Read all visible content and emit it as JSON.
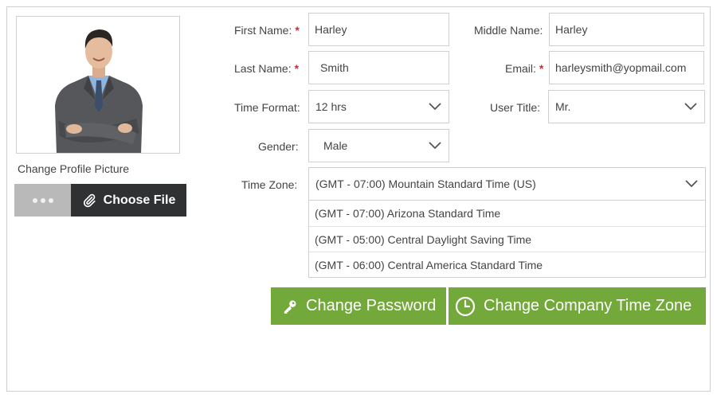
{
  "profile": {
    "change_picture_label": "Change Profile Picture",
    "choose_file_label": "Choose File"
  },
  "form": {
    "first_name": {
      "label": "First Name:",
      "required": "*",
      "value": "Harley"
    },
    "middle_name": {
      "label": "Middle Name:",
      "value": "Harley"
    },
    "last_name": {
      "label": "Last Name:",
      "required": "*",
      "value": "Smith"
    },
    "email": {
      "label": "Email:",
      "required": "*",
      "value": "harleysmith@yopmail.com"
    },
    "time_format": {
      "label": "Time Format:",
      "value": "12 hrs"
    },
    "user_title": {
      "label": "User Title:",
      "value": "Mr."
    },
    "gender": {
      "label": "Gender:",
      "value": "Male"
    },
    "time_zone": {
      "label": "Time Zone:",
      "value": "(GMT - 07:00) Mountain Standard Time (US)",
      "options": [
        "(GMT - 07:00) Arizona Standard Time",
        "(GMT - 05:00) Central Daylight Saving Time",
        "(GMT - 06:00) Central America Standard Time"
      ]
    }
  },
  "actions": {
    "change_password_label": "Change Password",
    "change_timezone_label": "Change Company Time Zone"
  },
  "colors": {
    "accent_green": "#73a83b",
    "required_red": "#d9262b",
    "dark_button": "#2f3133"
  }
}
